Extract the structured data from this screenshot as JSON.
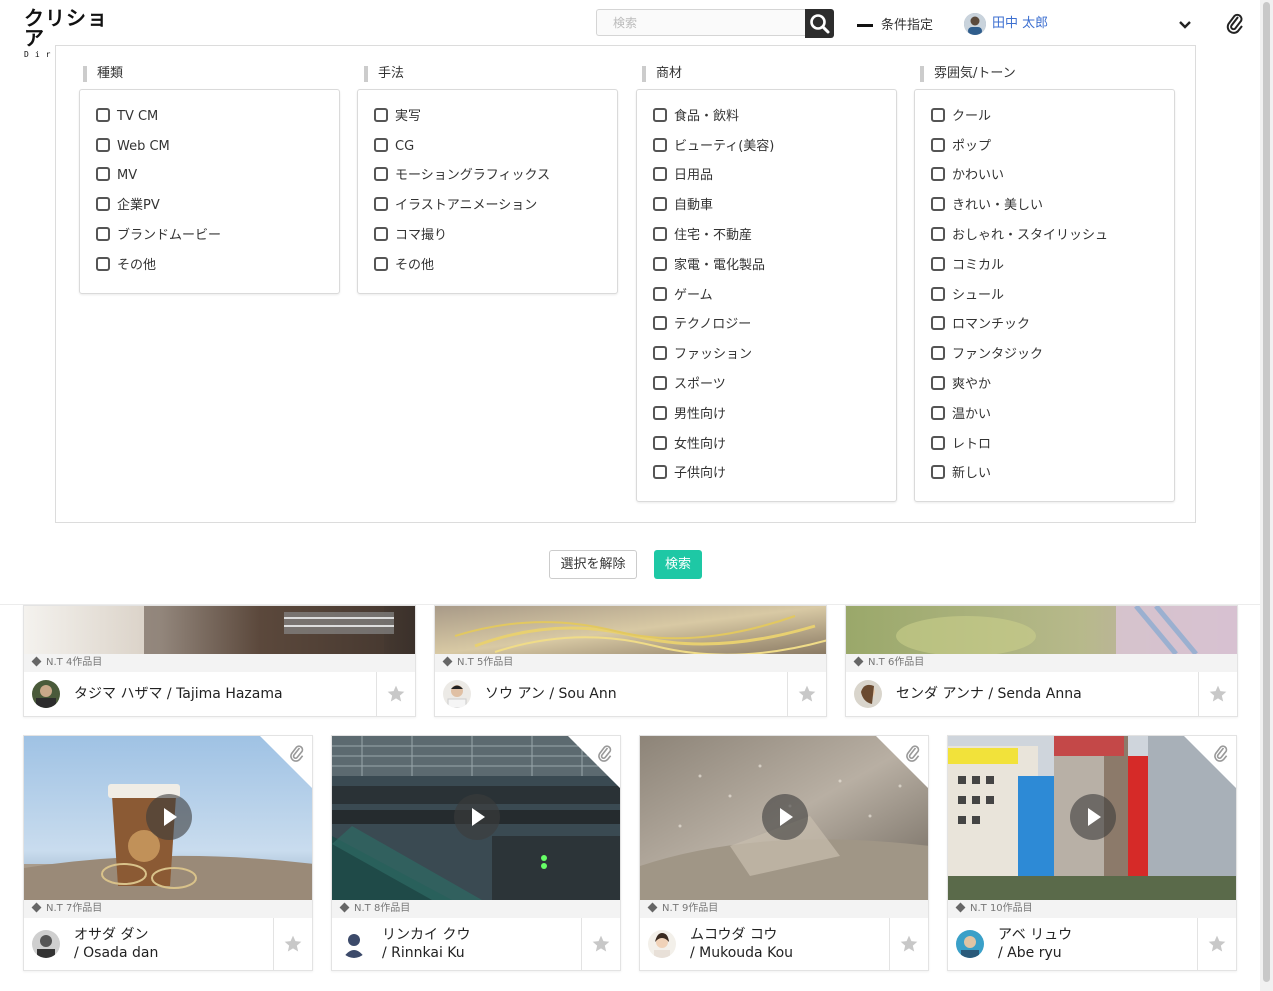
{
  "header": {
    "logo_main": "クリショア",
    "logo_sub": "Directors",
    "search_placeholder": "検索",
    "conditions_label": "条件指定",
    "user_name": "田中 太郎"
  },
  "filters": {
    "columns": [
      {
        "title": "種類",
        "options": [
          "TV CM",
          "Web CM",
          "MV",
          "企業PV",
          "ブランドムービー",
          "その他"
        ]
      },
      {
        "title": "手法",
        "options": [
          "実写",
          "CG",
          "モーショングラフィックス",
          "イラストアニメーション",
          "コマ撮り",
          "その他"
        ]
      },
      {
        "title": "商材",
        "options": [
          "食品・飲料",
          "ビューティ(美容)",
          "日用品",
          "自動車",
          "住宅・不動産",
          "家電・電化製品",
          "ゲーム",
          "テクノロジー",
          "ファッション",
          "スポーツ",
          "男性向け",
          "女性向け",
          "子供向け"
        ]
      },
      {
        "title": "雰囲気/トーン",
        "options": [
          "クール",
          "ポップ",
          "かわいい",
          "きれい・美しい",
          "おしゃれ・スタイリッシュ",
          "コミカル",
          "シュール",
          "ロマンチック",
          "ファンタジック",
          "爽やか",
          "温かい",
          "レトロ",
          "新しい"
        ]
      }
    ],
    "clear_label": "選択を解除",
    "search_label": "検索"
  },
  "cards_row1": [
    {
      "meta": "N.T 4作品目",
      "name": "タジマ ハザマ / Tajima Hazama"
    },
    {
      "meta": "N.T 5作品目",
      "name": "ソウ アン / Sou Ann"
    },
    {
      "meta": "N.T 6作品目",
      "name": "センダ アンナ / Senda Anna"
    }
  ],
  "cards_row2": [
    {
      "meta": "N.T 7作品目",
      "name_line1": "オサダ ダン",
      "name_line2": "/ Osada dan"
    },
    {
      "meta": "N.T 8作品目",
      "name_line1": "リンカイ クウ",
      "name_line2": "/ Rinnkai Ku"
    },
    {
      "meta": "N.T 9作品目",
      "name_line1": "ムコウダ コウ",
      "name_line2": "/ Mukouda Kou"
    },
    {
      "meta": "N.T 10作品目",
      "name_line1": "アベ リュウ",
      "name_line2": "/ Abe ryu"
    }
  ],
  "colors": {
    "accent": "#1ec8a5",
    "user_link": "#3c6fd0",
    "search_button": "#2d2d2d"
  },
  "icons": {
    "search": "search-icon",
    "clip": "paperclip-icon",
    "chevron": "chevron-down-icon",
    "star": "star-icon",
    "play": "play-icon"
  }
}
